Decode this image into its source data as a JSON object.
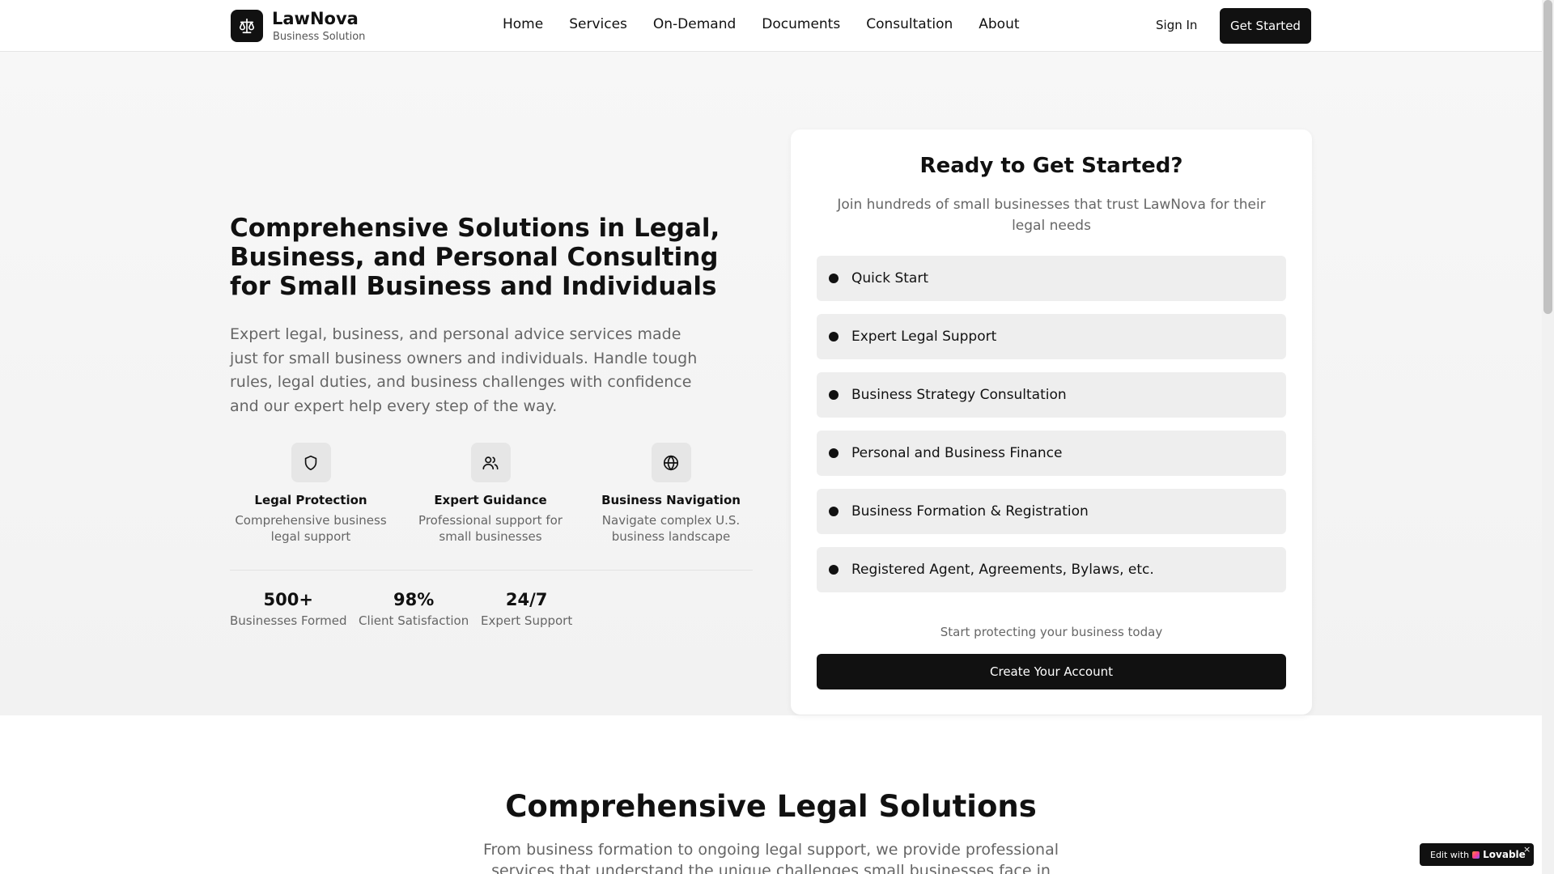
{
  "header": {
    "brand_name": "LawNova",
    "brand_sub": "Business Solution",
    "logo_icon": "scale-icon",
    "nav": [
      "Home",
      "Services",
      "On-Demand",
      "Documents",
      "Consultation",
      "About"
    ],
    "sign_in": "Sign In",
    "get_started": "Get Started"
  },
  "hero": {
    "title": "Comprehensive Solutions in Legal, Business, and Personal Consulting for Small Business and Individuals",
    "description": "Expert legal, business, and personal advice services made just for small business owners and individuals. Handle tough rules, legal duties, and business challenges with confidence and our expert help every step of the way.",
    "features": [
      {
        "icon": "shield-icon",
        "title": "Legal Protection",
        "desc": "Comprehensive business legal support"
      },
      {
        "icon": "users-icon",
        "title": "Expert Guidance",
        "desc": "Professional support for small businesses"
      },
      {
        "icon": "globe-icon",
        "title": "Business Navigation",
        "desc": "Navigate complex U.S. business landscape"
      }
    ],
    "stats": [
      {
        "value": "500+",
        "label": "Businesses Formed"
      },
      {
        "value": "98%",
        "label": "Client Satisfaction"
      },
      {
        "value": "24/7",
        "label": "Expert Support"
      }
    ]
  },
  "card": {
    "title": "Ready to Get Started?",
    "subtitle": "Join hundreds of small businesses that trust LawNova for their legal needs",
    "options": [
      "Quick Start",
      "Expert Legal Support",
      "Business Strategy Consultation",
      "Personal and Business Finance",
      "Business Formation & Registration",
      "Registered Agent, Agreements, Bylaws, etc."
    ],
    "note": "Start protecting your business today",
    "cta": "Create Your Account"
  },
  "section2": {
    "title": "Comprehensive Legal Solutions",
    "description": "From business formation to ongoing legal support, we provide professional services that understand the unique challenges small businesses face in today's complex"
  },
  "badge": {
    "prefix": "Edit with",
    "brand": "Lovable",
    "close": "×"
  },
  "colors": {
    "primary": "#111111",
    "muted_text": "#666666",
    "option_bg": "#eeeeee",
    "hero_bg": "#f5f5f5"
  }
}
